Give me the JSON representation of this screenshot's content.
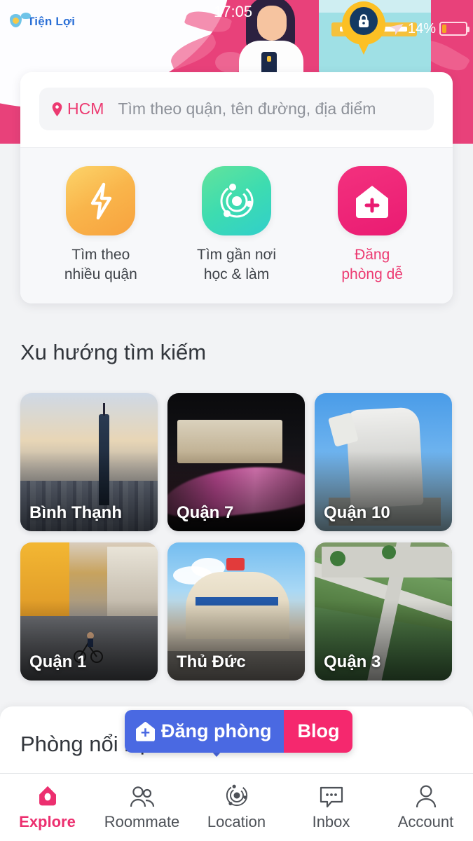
{
  "status_bar": {
    "time": "17:05",
    "battery_percent": "14%",
    "icons": [
      "lock-icon",
      "navigation-arrow-icon",
      "battery-low-icon"
    ]
  },
  "brand": {
    "name": "Tiện Lợi",
    "color": "#2a6fd6"
  },
  "header": {
    "background_color": "#e8417a",
    "illustration": "woman-with-phone-illustration"
  },
  "search": {
    "location_label": "HCM",
    "placeholder": "Tìm theo quận, tên đường, địa điểm",
    "value": "",
    "accent_color": "#ec3a71"
  },
  "quick_actions": [
    {
      "id": "multi-district",
      "icon": "lightning-bolt-icon",
      "line1": "Tìm theo",
      "line2": "nhiều quận",
      "color": "#f9b54b",
      "highlight": false
    },
    {
      "id": "near-school-work",
      "icon": "radar-orbit-icon",
      "line1": "Tìm gần nơi",
      "line2": "học & làm",
      "color": "#3ddcb0",
      "highlight": false
    },
    {
      "id": "post-room",
      "icon": "house-plus-icon",
      "line1": "Đăng",
      "line2": "phòng dễ",
      "color": "#ea1b72",
      "highlight": true
    }
  ],
  "trending": {
    "title": "Xu hướng tìm kiếm",
    "tiles": [
      {
        "label": "Bình Thạnh",
        "art": "landmark81-skyline"
      },
      {
        "label": "Quận 7",
        "art": "night-bridge-lighttrail"
      },
      {
        "label": "Quận 10",
        "art": "monument-statue"
      },
      {
        "label": "Quận 1",
        "art": "street-cyclist"
      },
      {
        "label": "Thủ Đức",
        "art": "cho-thu-duc-market"
      },
      {
        "label": "Quận 3",
        "art": "canal-walkway-park"
      }
    ]
  },
  "featured": {
    "title": "Phòng nổi bật"
  },
  "floating_buttons": {
    "post_room": {
      "label": "Đăng phòng",
      "icon": "house-plus-icon",
      "color": "#4a69e2"
    },
    "blog": {
      "label": "Blog",
      "color": "#f5286e"
    }
  },
  "tabbar": {
    "active_color": "#ec2f6f",
    "items": [
      {
        "id": "explore",
        "label": "Explore",
        "icon": "home-pin-icon",
        "active": true
      },
      {
        "id": "roommate",
        "label": "Roommate",
        "icon": "people-icon",
        "active": false
      },
      {
        "id": "location",
        "label": "Location",
        "icon": "radar-orbit-icon",
        "active": false
      },
      {
        "id": "inbox",
        "label": "Inbox",
        "icon": "chat-bubble-icon",
        "active": false
      },
      {
        "id": "account",
        "label": "Account",
        "icon": "person-icon",
        "active": false
      }
    ]
  }
}
